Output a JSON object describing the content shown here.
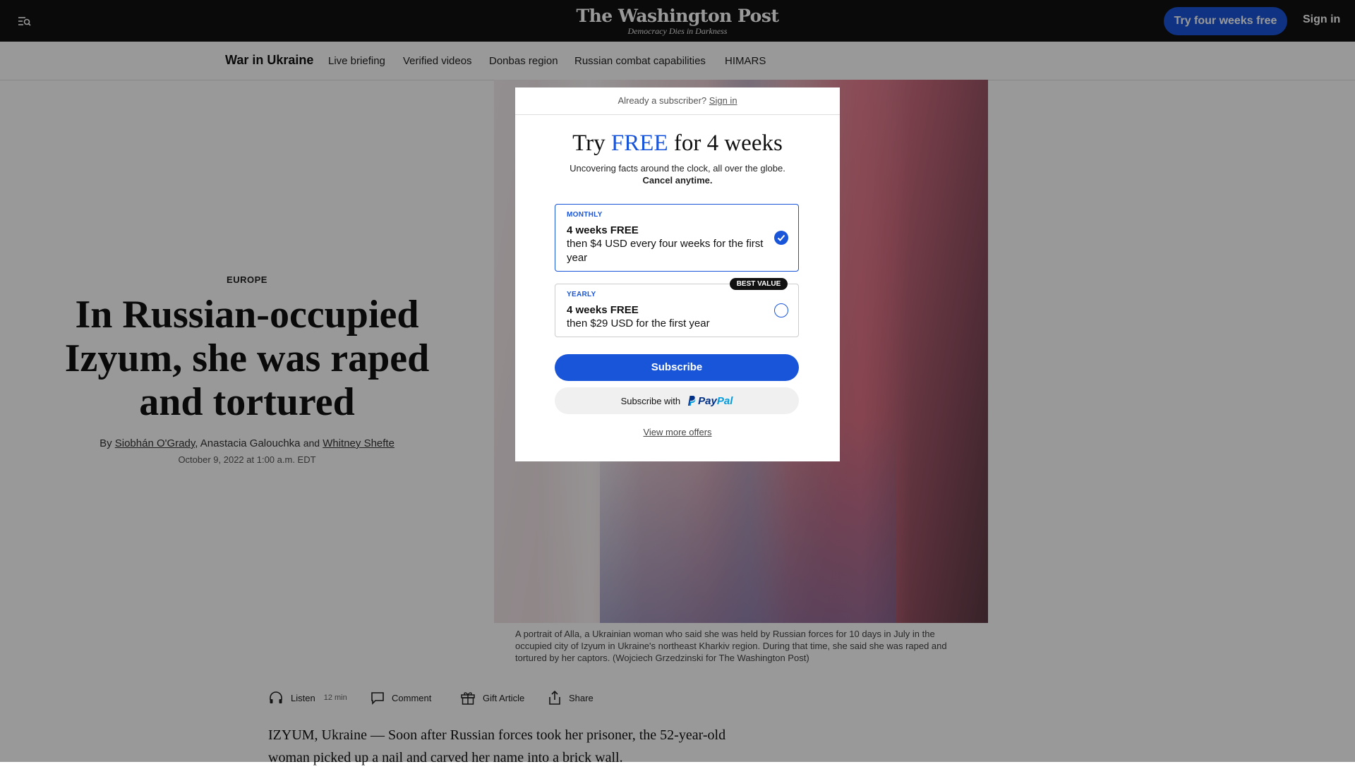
{
  "header": {
    "logo": "The Washington Post",
    "tagline": "Democracy Dies in Darkness",
    "cta_label": "Try four weeks free",
    "signin_label": "Sign in"
  },
  "subnav": {
    "title": "War in Ukraine",
    "links": [
      "Live briefing",
      "Verified videos",
      "Donbas region",
      "Russian combat capabilities",
      "HIMARS"
    ]
  },
  "article": {
    "kicker": "EUROPE",
    "headline": "In Russian-occupied Izyum, she was raped and tortured",
    "byline_prefix": "By",
    "authors": [
      "Siobhán O'Grady",
      "Anastacia Galouchka",
      "Whitney Shefte"
    ],
    "byline_and": "and",
    "date": "October 9, 2022 at 1:00 a.m. EDT",
    "caption": "A portrait of Alla, a Ukrainian woman who said she was held by Russian forces for 10 days in July in the occupied city of Izyum in Ukraine's northeast Kharkiv region. During that time, she said she was raped and tortured by her captors. (Wojciech Grzedzinski for The Washington Post)",
    "body_first": "IZYUM, Ukraine — Soon after Russian forces took her prisoner, the 52-year-old woman picked up a nail and carved her name into a brick wall."
  },
  "toolbar": {
    "listen_label": "Listen",
    "listen_minutes": "12 min",
    "comment_label": "Comment",
    "gift_label": "Gift Article",
    "share_label": "Share"
  },
  "modal": {
    "already_text": "Already a subscriber?",
    "signin_label": "Sign in",
    "title_pre": "Try",
    "title_free": "FREE",
    "title_post": "for 4 weeks",
    "subtitle": "Uncovering facts around the clock, all over the globe.",
    "cancel_text": "Cancel anytime.",
    "monthly": {
      "tag": "MONTHLY",
      "title": "4 weeks FREE",
      "desc": "then $4 USD every four weeks for the first year",
      "selected": true
    },
    "yearly": {
      "tag": "YEARLY",
      "title": "4 weeks FREE",
      "desc": "then $29 USD for the first year",
      "badge": "BEST VALUE",
      "selected": false
    },
    "subscribe_label": "Subscribe",
    "paypal_prefix": "Subscribe with",
    "paypal_pay": "Pay",
    "paypal_pal": "Pal",
    "more_offers": "View more offers"
  },
  "colors": {
    "accent": "#1955d9",
    "topbar": "#111111",
    "overlay": "rgba(0,0,0,0.40)"
  },
  "icons": [
    "menu-search-icon",
    "headphones-icon",
    "comment-icon",
    "gift-icon",
    "share-icon",
    "checkmark-icon",
    "paypal-icon"
  ]
}
